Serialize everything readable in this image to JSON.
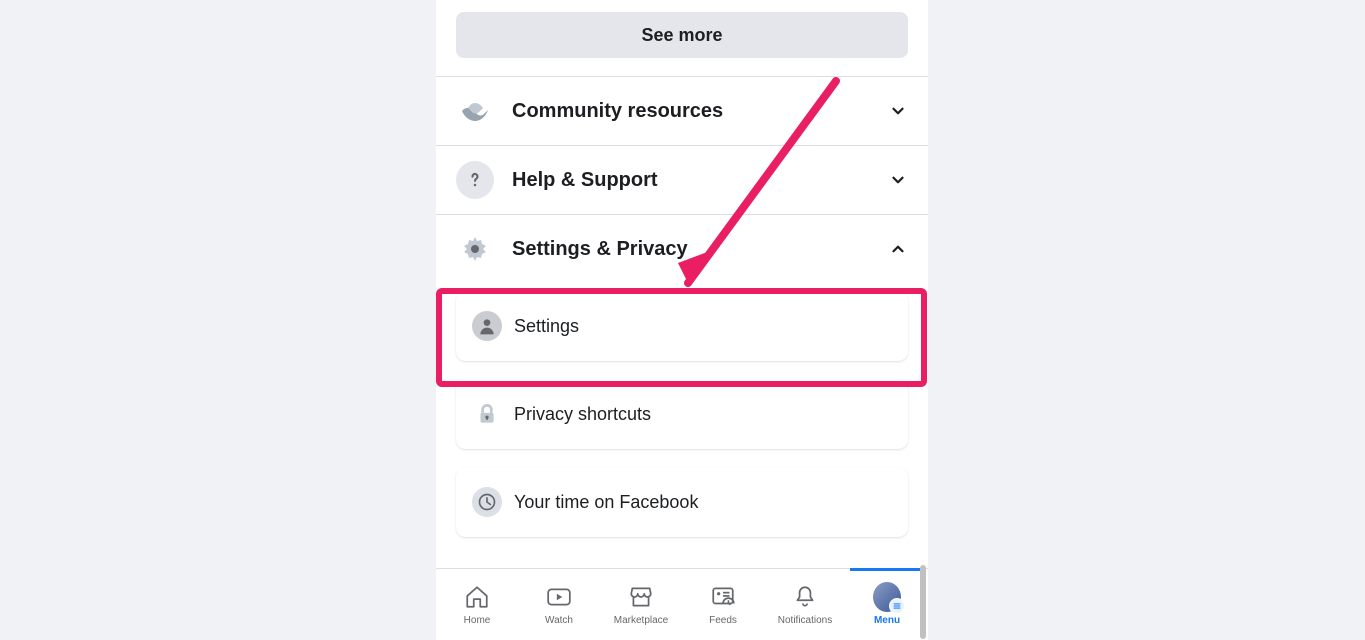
{
  "seeMoreLabel": "See more",
  "accordions": {
    "community": {
      "label": "Community resources"
    },
    "help": {
      "label": "Help & Support"
    },
    "settingsPrivacy": {
      "label": "Settings & Privacy"
    }
  },
  "subItems": {
    "settings": {
      "label": "Settings"
    },
    "privacyShortcuts": {
      "label": "Privacy shortcuts"
    },
    "yourTime": {
      "label": "Your time on Facebook"
    }
  },
  "bottomNav": {
    "home": "Home",
    "watch": "Watch",
    "marketplace": "Marketplace",
    "feeds": "Feeds",
    "notifications": "Notifications",
    "menu": "Menu"
  },
  "annotation": {
    "highlightTarget": "settings-sub-item",
    "highlightColor": "#e91e63"
  }
}
